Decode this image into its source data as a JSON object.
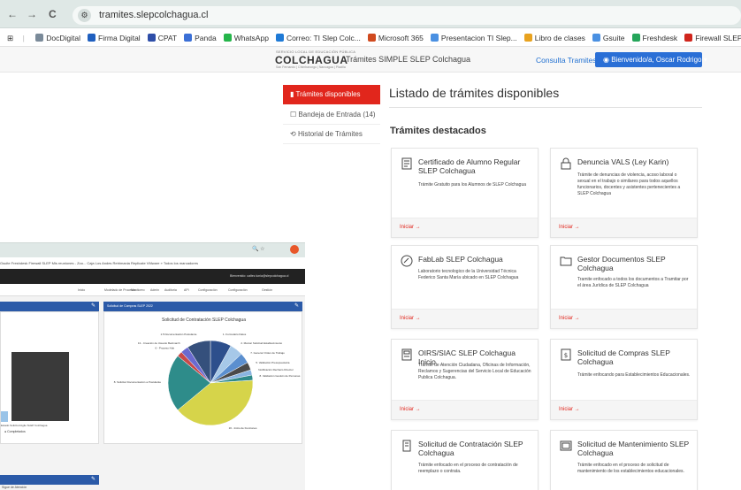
{
  "browser": {
    "url": "tramites.slepcolchagua.cl",
    "back": "←",
    "forward": "→",
    "reload": "C",
    "bookmarks": [
      {
        "label": "DocDigital",
        "color": "#7a8a99"
      },
      {
        "label": "Firma Digital",
        "color": "#1f5fbf"
      },
      {
        "label": "CPAT",
        "color": "#2e4ea8"
      },
      {
        "label": "Panda",
        "color": "#3b6fd6"
      },
      {
        "label": "WhatsApp",
        "color": "#25b54a"
      },
      {
        "label": "Correo: TI Slep Colc...",
        "color": "#1f7ad6"
      },
      {
        "label": "Microsoft 365",
        "color": "#d04a1f"
      },
      {
        "label": "Presentacion TI Slep...",
        "color": "#4a90e2"
      },
      {
        "label": "Libro de clases",
        "color": "#e8a21f"
      },
      {
        "label": "Gsuite",
        "color": "#4a90e2"
      },
      {
        "label": "Freshdesk",
        "color": "#25a55a"
      },
      {
        "label": "Firewall SLEP",
        "color": "#d0251c"
      },
      {
        "label": "Mis reuniones - Zoo...",
        "color": "#2d8cff"
      },
      {
        "label": "Caja Los Andes",
        "color": "#1f6fd1"
      }
    ]
  },
  "header": {
    "logo_small": "SERVICIO LOCAL DE EDUCACIÓN PÚBLICA",
    "logo_main": "COLCHAGUA",
    "logo_sub": "San Fernando | Chimbarongo | Nancagua | Placilla",
    "app_title": "Trámites SIMPLE SLEP Colchagua",
    "consulta": "Consulta Tramites",
    "user": "Bienvenido/a, Oscar Rodrigo"
  },
  "sidebar": {
    "items": [
      {
        "label": "Trámites disponibles",
        "icon": "document-icon"
      },
      {
        "label": "Bandeja de Entrada (14)",
        "icon": "inbox-icon"
      },
      {
        "label": "Historial de Trámites",
        "icon": "history-icon"
      }
    ]
  },
  "main": {
    "title": "Listado de trámites disponibles",
    "section": "Trámites destacados",
    "cards": [
      {
        "title": "Certificado de Alumno Regular SLEP Colchagua",
        "desc": "Trámite Gratuito para los Alumnos de SLEP Colchagua",
        "link": "Iniciar →",
        "icon": "certificate-icon"
      },
      {
        "title": "Denuncia VALS (Ley Karin)",
        "desc": "Trámite de denuncias de violencia, acoso laboral o sexual en el trabajo o similares para todos aquellos funcionarios, docentes y asistentes pertenecientes a SLEP Colchagua",
        "link": "Iniciar →",
        "icon": "lock-icon"
      },
      {
        "title": "FabLab SLEP Colchagua",
        "desc": "Laboratorio tecnologico de la Universidad Técnica Federico Santa María ubicado en SLEP Colchagua",
        "link": "Iniciar →",
        "icon": "link-icon"
      },
      {
        "title": "Gestor Documentos SLEP Colchagua",
        "desc": "Tramite enfocado a todos los documentos a Tramitar por el área Jurídica de SLEP Colchagua",
        "link": "Iniciar →",
        "icon": "folder-icon"
      },
      {
        "title": "OIRS/SIAC SLEP Colchagua Inicio",
        "desc": "Trámite de Atención Ciudadana, Oficinas de Información, Reclamos y Sugerencias del Servicio Local de Educación Publica Colchagua.",
        "link": "Iniciar →",
        "icon": "form-icon"
      },
      {
        "title": "Solicitud de Compras SLEP Colchagua",
        "desc": "Trámite enfocando para Establecimientos Educacionales.",
        "link": "Iniciar →",
        "icon": "receipt-icon"
      },
      {
        "title": "Solicitud de Contratación SLEP Colchagua",
        "desc": "Trámite enfocado en el proceso de contratación de reemplazo o contrata.",
        "link": "",
        "icon": "contract-icon"
      },
      {
        "title": "Solicitud de Mantenimiento SLEP Colchagua",
        "desc": "Trámite enfocado en el proceso de solicitud de mantenimiento de los establecimientos educacionales.",
        "link": "",
        "icon": "maintenance-icon"
      }
    ]
  },
  "overlay": {
    "bookmarks_text": "Gsuite   Freshdesk   Firewall SLEP   Mis reuniones - Zoo...   Caja Los Andes   Retrimania   Replicate   VMware   »   Todos los marcadores",
    "dark_text": "Bienvenido: oaltez.lunia@slepcolchagua.cl",
    "menu": [
      "Inicio",
      "Modelado de Procesos",
      "Monitoreo",
      "Admin",
      "Auditoria",
      "API",
      "Configuración",
      "Configuración",
      "Gestión"
    ],
    "panel1_legend": "Completados",
    "panel1_caption": "Estado Solicitud Agile SLEP Colchagua",
    "panel2_title": "Solicitud de Compras SLEP 2022",
    "bottom_note": "Sigue de Atención"
  },
  "chart_data": {
    "type": "pie",
    "title": "Solicitud de Contratación SLEP Colchagua",
    "slices": [
      {
        "label": "1. Formulario Datos",
        "value": 8,
        "color": "#2d4f8c"
      },
      {
        "label": "2. Marcar Solicitud Establecimiento",
        "value": 5,
        "color": "#a6c8e8"
      },
      {
        "label": "7. Generar Orden de Trabajo",
        "value": 4,
        "color": "#5b8fcf"
      },
      {
        "label": "5. Validación Presupuestaria",
        "value": 3,
        "color": "#4a4a4a"
      },
      {
        "label": "Notificación Rechazo Director",
        "value": 2,
        "color": "#8ab4e0"
      },
      {
        "label": "8. Validación Gestión de Personas",
        "value": 2,
        "color": "#2f8a8a"
      },
      {
        "label": "16 - Inicio de Funciones",
        "value": 40,
        "color": "#d6d44a"
      },
      {
        "label": "8. Solicitar Documentación a Postulante",
        "value": 22,
        "color": "#2e8c8a"
      },
      {
        "label": "6 - Proceso Hub",
        "value": 2,
        "color": "#c84a4a"
      },
      {
        "label": "13 - Creación de Usuario Bedmarch",
        "value": 3,
        "color": "#6a6ad0"
      },
      {
        "label": "1.5 Documentación Postulante",
        "value": 9,
        "color": "#35507c"
      }
    ]
  }
}
